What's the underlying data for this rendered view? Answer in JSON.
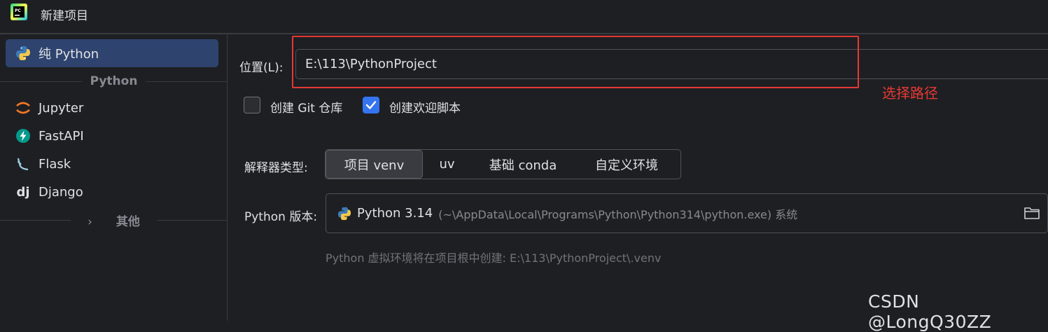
{
  "window": {
    "title": "新建项目"
  },
  "sidebar": {
    "items": [
      {
        "label": "纯 Python",
        "icon": "python-icon",
        "selected": true
      },
      {
        "label": "Jupyter",
        "icon": "jupyter-icon"
      },
      {
        "label": "FastAPI",
        "icon": "fastapi-icon"
      },
      {
        "label": "Flask",
        "icon": "flask-icon"
      },
      {
        "label": "Django",
        "icon": "django-icon"
      }
    ],
    "group_python": "Python",
    "group_other": "其他"
  },
  "form": {
    "location_label": "位置(L):",
    "location_value": "E:\\113\\PythonProject",
    "annotation": "选择路径",
    "git_label": "创建 Git 仓库",
    "git_checked": false,
    "welcome_label": "创建欢迎脚本",
    "welcome_checked": true,
    "interpreter_label": "解释器类型:",
    "interpreter_options": [
      "项目 venv",
      "uv",
      "基础 conda",
      "自定义环境"
    ],
    "python_version_label": "Python 版本:",
    "python_version_name": "Python 3.14",
    "python_version_path": "(~\\AppData\\Local\\Programs\\Python\\Python314\\python.exe) 系统",
    "venv_hint": "Python 虚拟环境将在项目根中创建: E:\\113\\PythonProject\\.venv"
  },
  "watermark": "CSDN @LongQ30ZZ",
  "colors": {
    "accent": "#3574f0",
    "selected_bg": "#2e436e",
    "annotation": "#e53935"
  }
}
